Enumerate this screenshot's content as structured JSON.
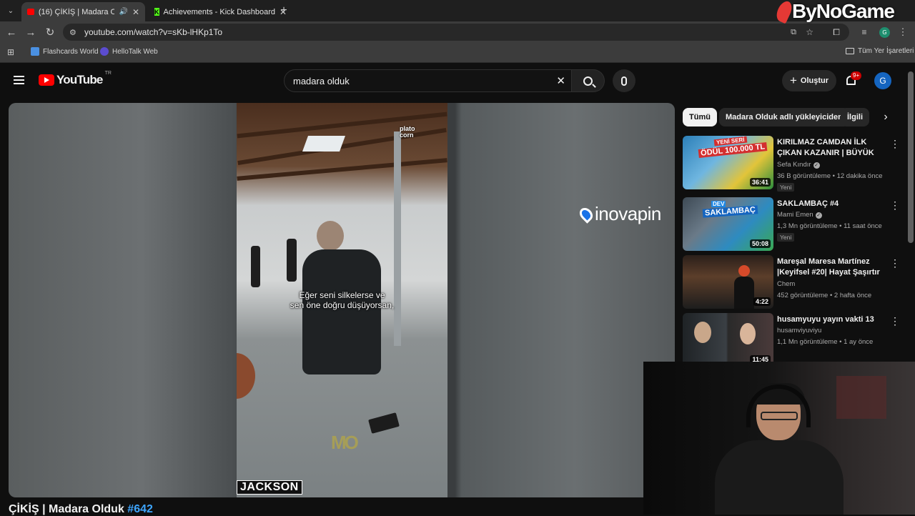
{
  "browser": {
    "tabs": [
      {
        "label": "(16) ÇİKİŞ | Madara Olduk",
        "active": true
      },
      {
        "label": "Achievements - Kick Dashboard",
        "active": false
      }
    ],
    "url": "youtube.com/watch?v=sKb-lHKp1To",
    "bookmarks": [
      "Flashcards World",
      "HelloTalk Web"
    ],
    "bookmarks_folder": "Tüm Yer İşaretleri",
    "profile_initial": "G"
  },
  "youtube": {
    "logo_text": "YouTube",
    "region": "TR",
    "search_query": "madara olduk",
    "create_label": "Oluştur",
    "notif_count": "9+",
    "avatar_initial": "G"
  },
  "player": {
    "channel_watermark": "plato corn",
    "subtitle_line1": "Eğer seni silkelerse ve",
    "subtitle_line2": "sen öne doğru düşüyorsan,",
    "name_tag": "JACKSON",
    "sponsor": "inovapin",
    "corner_logo": "MO"
  },
  "video": {
    "title_main": "ÇİKİŞ | Madara Olduk",
    "title_tag": "#642"
  },
  "chips": [
    "Tümü",
    "Madara Olduk adlı yükleyiciden",
    "İlgili"
  ],
  "recommendations": [
    {
      "title": "KIRILMAZ CAMDAN İLK ÇIKAN KAZANIR | BÜYÜK ÖDÜL",
      "channel": "Sefa Kındır",
      "verified": true,
      "meta": "36 B görüntüleme • 12 dakika önce",
      "badge": "Yeni",
      "duration": "36:41",
      "thumb_text": "ÖDÜL 100.000 TL",
      "thumb_sub": "YENİ SERİ"
    },
    {
      "title": "SAKLAMBAÇ #4",
      "channel": "Mami Emen",
      "verified": true,
      "meta": "1,3 Mn görüntüleme • 11 saat önce",
      "badge": "Yeni",
      "duration": "50:08",
      "thumb_text": "SAKLAMBAÇ",
      "thumb_sub": "DEV"
    },
    {
      "title": "Mareşal Maresa Martínez |Keyifsel #20| Hayat Şaşırtır ...",
      "channel": "Chem",
      "verified": false,
      "meta": "452 görüntüleme • 2 hafta önce",
      "badge": "",
      "duration": "4:22"
    },
    {
      "title": "husamyuyu yayın vakti 13",
      "channel": "husamviyuviyu",
      "verified": false,
      "meta": "1,1 Mn görüntüleme • 1 ay önce",
      "badge": "",
      "duration": "11:45"
    }
  ],
  "watermark": "ByNoGame",
  "colors": {
    "youtube_red": "#ff0000",
    "link_blue": "#3ea6ff",
    "kick_green": "#53fc18"
  }
}
